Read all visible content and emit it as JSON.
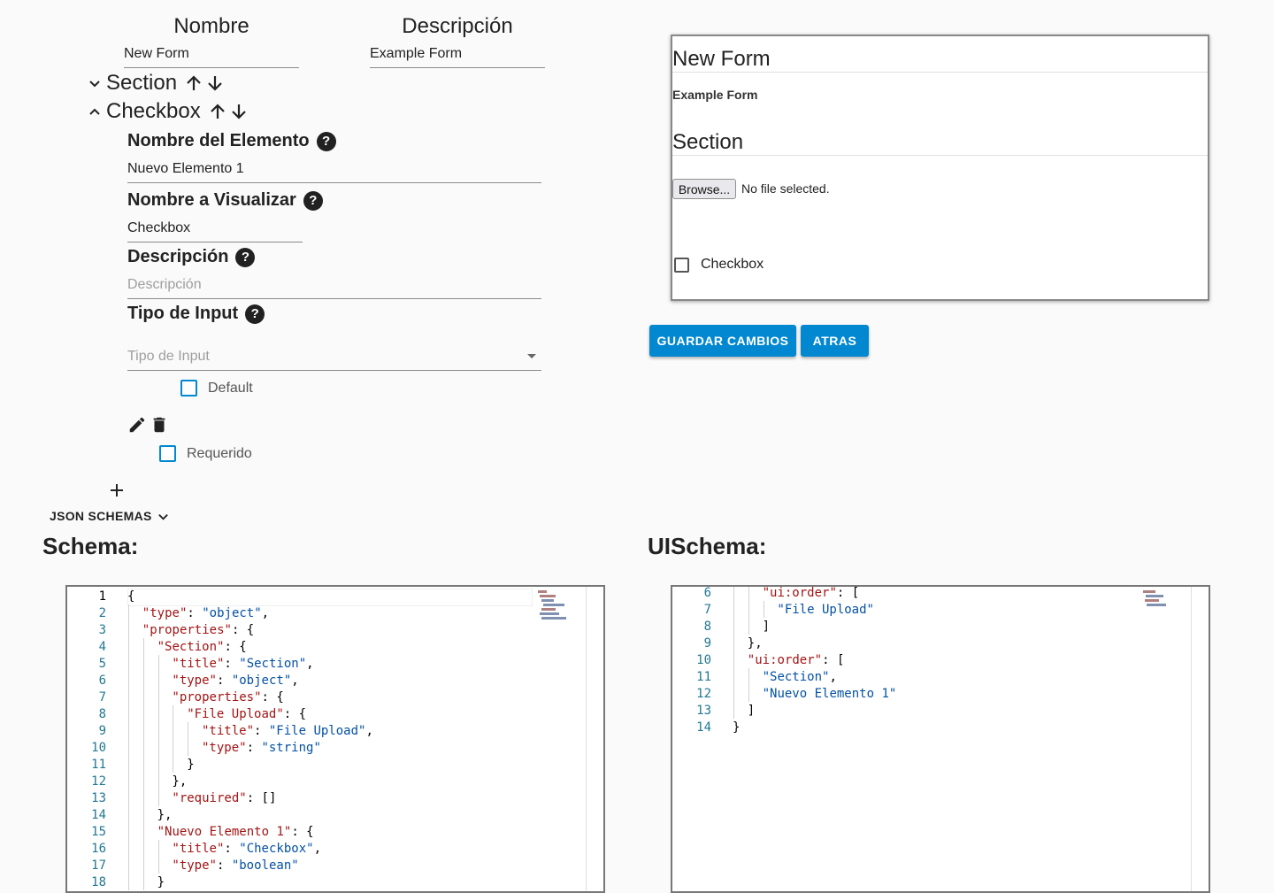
{
  "form": {
    "nombre_header": "Nombre",
    "descripcion_header": "Descripción",
    "nombre_value": "New Form",
    "descripcion_value": "Example Form"
  },
  "sections": [
    {
      "label": "Section",
      "expanded": false
    },
    {
      "label": "Checkbox",
      "expanded": true
    }
  ],
  "element": {
    "nombre_elemento_label": "Nombre del Elemento",
    "nombre_elemento_value": "Nuevo Elemento 1",
    "nombre_visualizar_label": "Nombre a Visualizar",
    "nombre_visualizar_value": "Checkbox",
    "descripcion_label": "Descripción",
    "descripcion_placeholder": "Descripción",
    "tipo_input_label": "Tipo de Input",
    "tipo_input_placeholder": "Tipo de Input",
    "default_label": "Default",
    "requerido_label": "Requerido"
  },
  "json_schemas_label": "JSON SCHEMAS",
  "preview": {
    "title": "New Form",
    "description": "Example Form",
    "section_title": "Section",
    "browse_label": "Browse...",
    "no_file_label": "No file selected.",
    "checkbox_label": "Checkbox"
  },
  "buttons": {
    "save": "GUARDAR CAMBIOS",
    "back": "ATRAS"
  },
  "schema_heading": "Schema:",
  "uischema_heading": "UISchema:",
  "schema_lines": [
    {
      "n": "1",
      "indent": 0,
      "parts": [
        [
          "p",
          "{"
        ]
      ]
    },
    {
      "n": "2",
      "indent": 1,
      "parts": [
        [
          "k",
          "\"type\""
        ],
        [
          "p",
          ": "
        ],
        [
          "s",
          "\"object\""
        ],
        [
          "p",
          ","
        ]
      ]
    },
    {
      "n": "3",
      "indent": 1,
      "parts": [
        [
          "k",
          "\"properties\""
        ],
        [
          "p",
          ": {"
        ]
      ]
    },
    {
      "n": "4",
      "indent": 2,
      "parts": [
        [
          "k",
          "\"Section\""
        ],
        [
          "p",
          ": {"
        ]
      ]
    },
    {
      "n": "5",
      "indent": 3,
      "parts": [
        [
          "k",
          "\"title\""
        ],
        [
          "p",
          ": "
        ],
        [
          "s",
          "\"Section\""
        ],
        [
          "p",
          ","
        ]
      ]
    },
    {
      "n": "6",
      "indent": 3,
      "parts": [
        [
          "k",
          "\"type\""
        ],
        [
          "p",
          ": "
        ],
        [
          "s",
          "\"object\""
        ],
        [
          "p",
          ","
        ]
      ]
    },
    {
      "n": "7",
      "indent": 3,
      "parts": [
        [
          "k",
          "\"properties\""
        ],
        [
          "p",
          ": {"
        ]
      ]
    },
    {
      "n": "8",
      "indent": 4,
      "parts": [
        [
          "k",
          "\"File Upload\""
        ],
        [
          "p",
          ": {"
        ]
      ]
    },
    {
      "n": "9",
      "indent": 5,
      "parts": [
        [
          "k",
          "\"title\""
        ],
        [
          "p",
          ": "
        ],
        [
          "s",
          "\"File Upload\""
        ],
        [
          "p",
          ","
        ]
      ]
    },
    {
      "n": "10",
      "indent": 5,
      "parts": [
        [
          "k",
          "\"type\""
        ],
        [
          "p",
          ": "
        ],
        [
          "s",
          "\"string\""
        ]
      ]
    },
    {
      "n": "11",
      "indent": 4,
      "parts": [
        [
          "p",
          "}"
        ]
      ]
    },
    {
      "n": "12",
      "indent": 3,
      "parts": [
        [
          "p",
          "},"
        ]
      ]
    },
    {
      "n": "13",
      "indent": 3,
      "parts": [
        [
          "k",
          "\"required\""
        ],
        [
          "p",
          ": []"
        ]
      ]
    },
    {
      "n": "14",
      "indent": 2,
      "parts": [
        [
          "p",
          "},"
        ]
      ]
    },
    {
      "n": "15",
      "indent": 2,
      "parts": [
        [
          "k",
          "\"Nuevo Elemento 1\""
        ],
        [
          "p",
          ": {"
        ]
      ]
    },
    {
      "n": "16",
      "indent": 3,
      "parts": [
        [
          "k",
          "\"title\""
        ],
        [
          "p",
          ": "
        ],
        [
          "s",
          "\"Checkbox\""
        ],
        [
          "p",
          ","
        ]
      ]
    },
    {
      "n": "17",
      "indent": 3,
      "parts": [
        [
          "k",
          "\"type\""
        ],
        [
          "p",
          ": "
        ],
        [
          "s",
          "\"boolean\""
        ]
      ]
    },
    {
      "n": "18",
      "indent": 2,
      "parts": [
        [
          "p",
          "}"
        ]
      ]
    }
  ],
  "uischema_lines": [
    {
      "n": "6",
      "indent": 2,
      "parts": [
        [
          "k",
          "\"ui:order\""
        ],
        [
          "p",
          ": ["
        ]
      ]
    },
    {
      "n": "7",
      "indent": 3,
      "parts": [
        [
          "s",
          "\"File Upload\""
        ]
      ]
    },
    {
      "n": "8",
      "indent": 2,
      "parts": [
        [
          "p",
          "]"
        ]
      ]
    },
    {
      "n": "9",
      "indent": 1,
      "parts": [
        [
          "p",
          "},"
        ]
      ]
    },
    {
      "n": "10",
      "indent": 1,
      "parts": [
        [
          "k",
          "\"ui:order\""
        ],
        [
          "p",
          ": ["
        ]
      ]
    },
    {
      "n": "11",
      "indent": 2,
      "parts": [
        [
          "s",
          "\"Section\""
        ],
        [
          "p",
          ","
        ]
      ]
    },
    {
      "n": "12",
      "indent": 2,
      "parts": [
        [
          "s",
          "\"Nuevo Elemento 1\""
        ]
      ]
    },
    {
      "n": "13",
      "indent": 1,
      "parts": [
        [
          "p",
          "]"
        ]
      ]
    },
    {
      "n": "14",
      "indent": 0,
      "parts": [
        [
          "p",
          "}"
        ]
      ]
    }
  ],
  "colors": {
    "accent": "#0288d1",
    "json_key": "#a31515",
    "json_string": "#0451a5",
    "line_number": "#237893"
  },
  "icons": [
    "chevron-down-icon",
    "chevron-up-icon",
    "arrow-up-icon",
    "arrow-down-icon",
    "help-icon",
    "edit-icon",
    "delete-icon",
    "add-icon",
    "dropdown-arrow-icon"
  ]
}
